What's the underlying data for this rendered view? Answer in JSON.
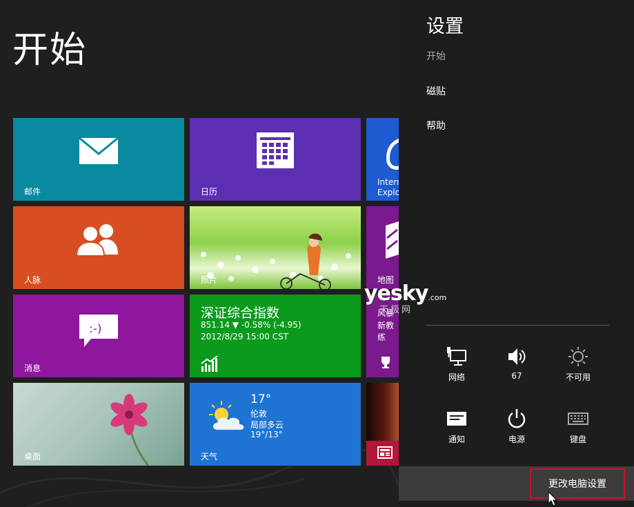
{
  "start": {
    "title": "开始",
    "tiles": {
      "mail": "邮件",
      "calendar": "日历",
      "ie": "Internet Explorer",
      "people": "人脉",
      "photos": "照片",
      "maps": "地图",
      "messaging": "消息",
      "stock": {
        "title": "深证综合指数",
        "line1": "851.14  ▼ -0.58% (-4.95)",
        "line2": "2012/8/29 15:00 CST"
      },
      "sports": "新教练",
      "sports_top": "风暴",
      "desktop": "桌面",
      "weather": {
        "label": "天气",
        "temp": "17°",
        "city": "伦敦",
        "condition": "局部多云",
        "range": "19°/13°"
      }
    }
  },
  "charm": {
    "title": "设置",
    "subtitle": "开始",
    "links": [
      "磁贴",
      "帮助"
    ],
    "quick": [
      {
        "label": "网络",
        "icon": "network-icon"
      },
      {
        "label": "67",
        "icon": "volume-icon"
      },
      {
        "label": "不可用",
        "icon": "brightness-icon"
      },
      {
        "label": "通知",
        "icon": "notifications-icon"
      },
      {
        "label": "电源",
        "icon": "power-icon"
      },
      {
        "label": "键盘",
        "icon": "keyboard-icon"
      }
    ],
    "change_pc_settings": "更改电脑设置"
  },
  "watermark": {
    "main": "yesky",
    "suffix": ".com",
    "cn": "天极网"
  },
  "colors": {
    "mail": "#0a8a9e",
    "calendar": "#5b2fb0",
    "ie": "#1e5bd0",
    "people": "#d64e22",
    "maps": "#7a1a8e",
    "messaging": "#8f179e",
    "finance": "#0c9a1c",
    "weather": "#1f74d3",
    "highlight": "#c8102e"
  }
}
